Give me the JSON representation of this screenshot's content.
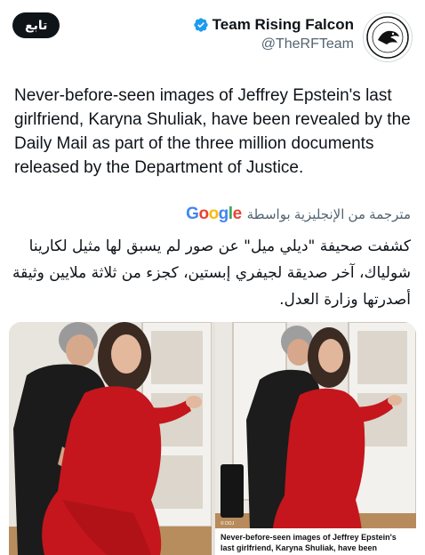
{
  "account": {
    "display_name": "Team Rising Falcon",
    "handle": "@TheRFTeam",
    "follow_label": "تابع"
  },
  "tweet": {
    "text": "Never-before-seen images of Jeffrey Epstein's last girlfriend, Karyna Shuliak, have been revealed by the Daily Mail as part of the three million documents released by the Department of Justice."
  },
  "translation": {
    "label": "مترجمة من الإنجليزية بواسطة",
    "provider": "Google",
    "text": "كشفت صحيفة \"ديلي ميل\" عن صور لم يسبق لها مثيل لكارينا شولياك، آخر صديقة لجيفري إبستين، كجزء من ثلاثة ملايين وثيقة أصدرتها وزارة العدل."
  },
  "media": {
    "caption": "Never-before-seen images of Jeffrey Epstein's last girlfriend, Karyna Shuliak, have been revealed by the",
    "credit": "© DOJ"
  },
  "colors": {
    "verified": "#1d9bf0",
    "follow_bg": "#0f1419",
    "dress": "#c4161c"
  }
}
